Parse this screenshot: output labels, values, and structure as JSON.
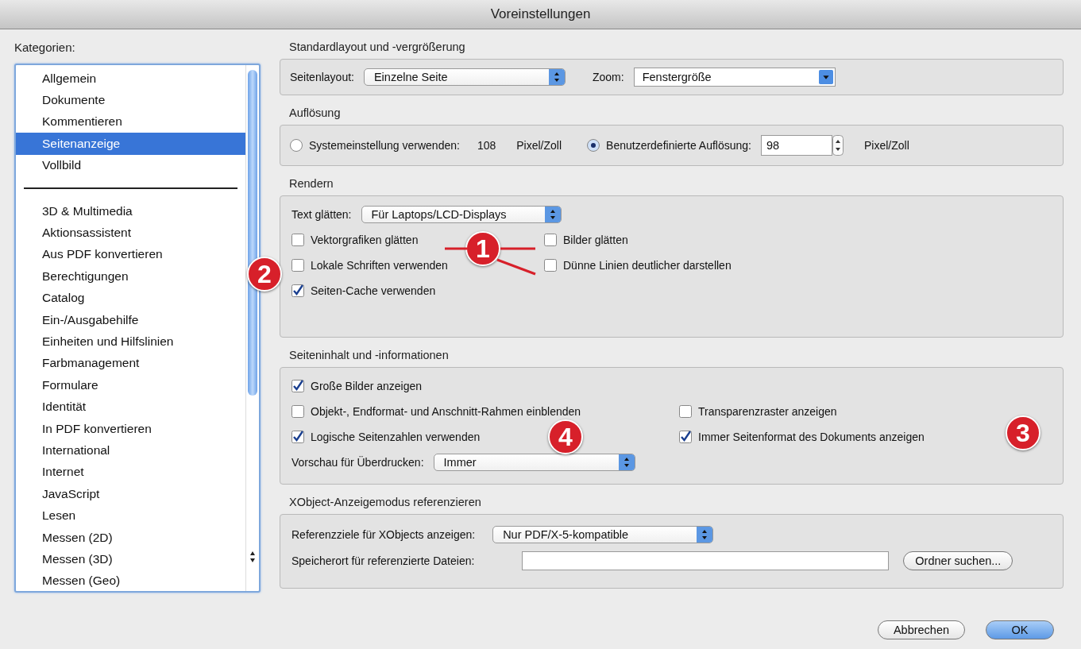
{
  "window": {
    "title": "Voreinstellungen"
  },
  "sidebar": {
    "label": "Kategorien:",
    "items": [
      {
        "kind": "item",
        "label": "Allgemein",
        "selected": false
      },
      {
        "kind": "item",
        "label": "Dokumente",
        "selected": false
      },
      {
        "kind": "item",
        "label": "Kommentieren",
        "selected": false
      },
      {
        "kind": "item",
        "label": "Seitenanzeige",
        "selected": true
      },
      {
        "kind": "item",
        "label": "Vollbild",
        "selected": false
      },
      {
        "kind": "separator"
      },
      {
        "kind": "item",
        "label": "3D & Multimedia",
        "selected": false
      },
      {
        "kind": "item",
        "label": "Aktionsassistent",
        "selected": false
      },
      {
        "kind": "item",
        "label": "Aus PDF konvertieren",
        "selected": false
      },
      {
        "kind": "item",
        "label": "Berechtigungen",
        "selected": false
      },
      {
        "kind": "item",
        "label": "Catalog",
        "selected": false
      },
      {
        "kind": "item",
        "label": "Ein-/Ausgabehilfe",
        "selected": false
      },
      {
        "kind": "item",
        "label": "Einheiten und Hilfslinien",
        "selected": false
      },
      {
        "kind": "item",
        "label": "Farbmanagement",
        "selected": false
      },
      {
        "kind": "item",
        "label": "Formulare",
        "selected": false
      },
      {
        "kind": "item",
        "label": "Identität",
        "selected": false
      },
      {
        "kind": "item",
        "label": "In PDF konvertieren",
        "selected": false
      },
      {
        "kind": "item",
        "label": "International",
        "selected": false
      },
      {
        "kind": "item",
        "label": "Internet",
        "selected": false
      },
      {
        "kind": "item",
        "label": "JavaScript",
        "selected": false
      },
      {
        "kind": "item",
        "label": "Lesen",
        "selected": false
      },
      {
        "kind": "item",
        "label": "Messen (2D)",
        "selected": false
      },
      {
        "kind": "item",
        "label": "Messen (3D)",
        "selected": false
      },
      {
        "kind": "item",
        "label": "Messen (Geo)",
        "selected": false
      }
    ]
  },
  "sections": [
    {
      "title": "Standardlayout und -vergrößerung",
      "rows": [
        [
          {
            "kind": "label",
            "text": "Seitenlayout:"
          },
          {
            "kind": "popup",
            "value": "Einzelne Seite"
          },
          {
            "kind": "label",
            "text": "Zoom:"
          },
          {
            "kind": "combo",
            "value": "Fenstergröße"
          }
        ]
      ]
    },
    {
      "title": "Auflösung",
      "rows": [
        [
          {
            "kind": "radio",
            "label": "Systemeinstellung verwenden:",
            "selected": false
          },
          {
            "kind": "label",
            "text": "108"
          },
          {
            "kind": "label",
            "text": "Pixel/Zoll"
          },
          {
            "kind": "radio",
            "label": "Benutzerdefinierte Auflösung:",
            "selected": true
          },
          {
            "kind": "number",
            "value": "98"
          },
          {
            "kind": "label",
            "text": "Pixel/Zoll"
          }
        ]
      ]
    },
    {
      "title": "Rendern",
      "rows": [
        [
          {
            "kind": "label",
            "text": "Text glätten:"
          },
          {
            "kind": "popup",
            "value": "Für Laptops/LCD-Displays"
          }
        ],
        [
          {
            "kind": "checkbox",
            "label": "Vektorgrafiken glätten",
            "checked": false
          },
          {
            "kind": "checkbox",
            "label": "Bilder glätten",
            "checked": false
          }
        ],
        [
          {
            "kind": "checkbox",
            "label": "Lokale Schriften verwenden",
            "checked": false
          },
          {
            "kind": "checkbox",
            "label": "Dünne Linien deutlicher darstellen",
            "checked": false
          }
        ],
        [
          {
            "kind": "checkbox",
            "label": "Seiten-Cache verwenden",
            "checked": true
          }
        ]
      ]
    },
    {
      "title": "Seiteninhalt und -informationen",
      "rows": [
        [
          {
            "kind": "checkbox",
            "label": "Große Bilder anzeigen",
            "checked": true
          }
        ],
        [
          {
            "kind": "checkbox",
            "label": "Objekt-, Endformat- und Anschnitt-Rahmen einblenden",
            "checked": false
          },
          {
            "kind": "checkbox",
            "label": "Transparenzraster anzeigen",
            "checked": false
          }
        ],
        [
          {
            "kind": "checkbox",
            "label": "Logische Seitenzahlen verwenden",
            "checked": true
          },
          {
            "kind": "checkbox",
            "label": "Immer Seitenformat des Dokuments anzeigen",
            "checked": true
          }
        ]
      ],
      "overprint_preview": {
        "label": "Vorschau für Überdrucken:",
        "value": "Immer"
      }
    },
    {
      "title": "XObject-Anzeigemodus referenzieren",
      "rows": [
        [
          {
            "kind": "label",
            "text": "Referenzziele für XObjects anzeigen:"
          },
          {
            "kind": "popup",
            "value": "Nur PDF/X-5-kompatible"
          }
        ],
        [
          {
            "kind": "label",
            "text": "Speicherort für referenzierte Dateien:"
          },
          {
            "kind": "input"
          },
          {
            "kind": "button",
            "label": "Ordner suchen..."
          }
        ]
      ]
    }
  ],
  "buttons": [
    {
      "label": "Abbrechen",
      "default": false
    },
    {
      "label": "OK",
      "default": true
    }
  ],
  "callouts": [
    {
      "number": "1"
    },
    {
      "number": "2"
    },
    {
      "number": "3"
    },
    {
      "number": "4"
    }
  ]
}
